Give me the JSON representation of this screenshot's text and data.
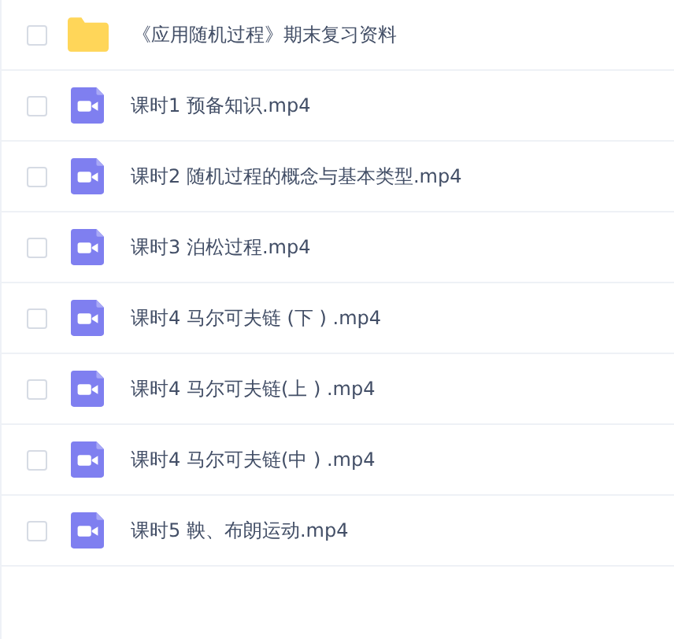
{
  "files": [
    {
      "kind": "folder",
      "name": "《应用随机过程》期末复习资料",
      "checked": false
    },
    {
      "kind": "video",
      "name": "课时1 预备知识.mp4",
      "checked": false
    },
    {
      "kind": "video",
      "name": "课时2 随机过程的概念与基本类型.mp4",
      "checked": false
    },
    {
      "kind": "video",
      "name": "课时3 泊松过程.mp4",
      "checked": false
    },
    {
      "kind": "video",
      "name": "课时4 马尔可夫链 (下 ) .mp4",
      "checked": false
    },
    {
      "kind": "video",
      "name": "课时4 马尔可夫链(上 ) .mp4",
      "checked": false
    },
    {
      "kind": "video",
      "name": "课时4 马尔可夫链(中 ) .mp4",
      "checked": false
    },
    {
      "kind": "video",
      "name": "课时5 鞅、布朗运动.mp4",
      "checked": false
    }
  ]
}
